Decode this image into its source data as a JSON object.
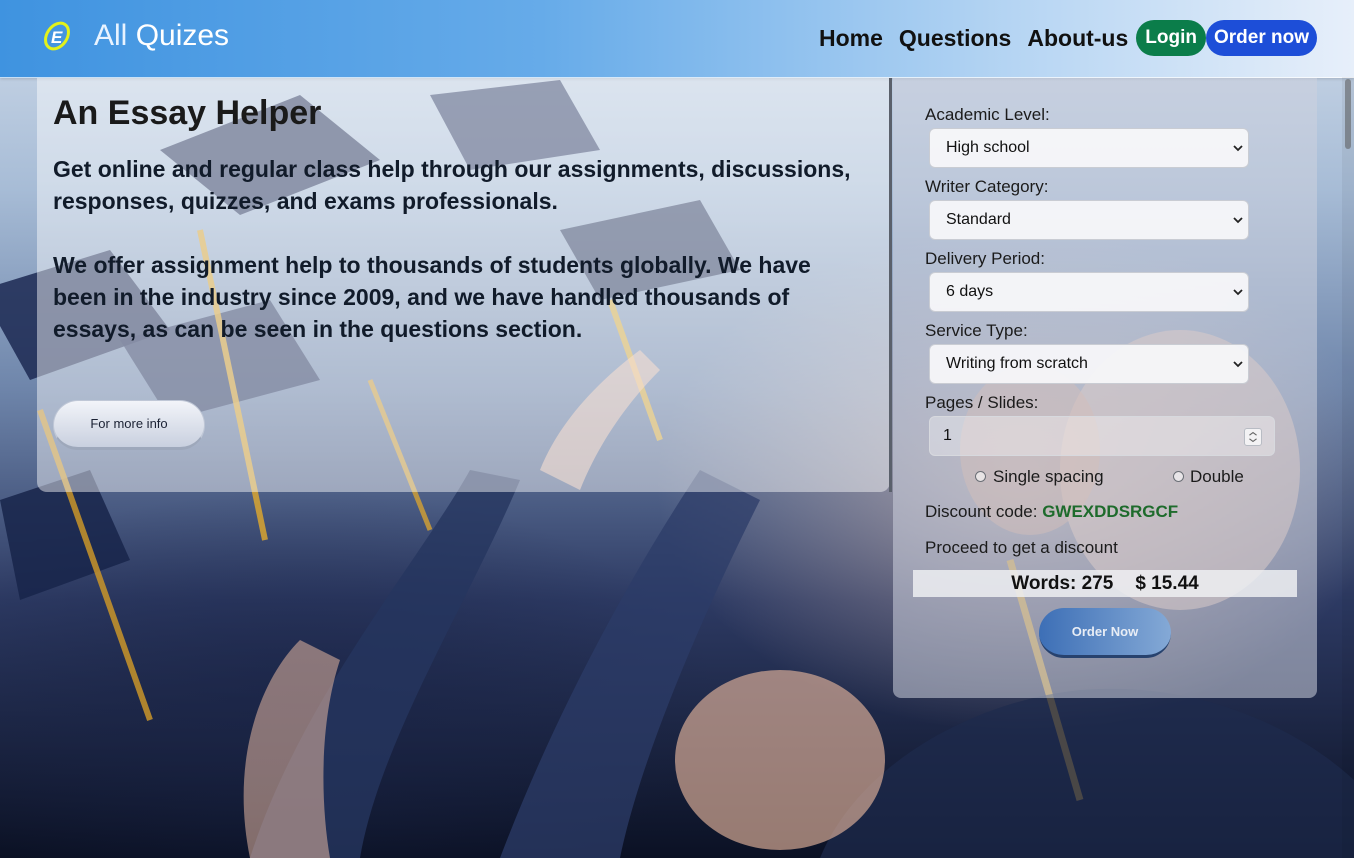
{
  "brand": {
    "logo_icon": "e-ring-logo-icon",
    "name_first": "All",
    "name_second": "Quizes"
  },
  "nav": {
    "home": "Home",
    "questions": "Questions",
    "about": "About-us",
    "login": "Login",
    "order_now": "Order now"
  },
  "hero": {
    "title": "An Essay Helper",
    "paragraph_1": "Get online and regular class help through our assignments, discussions, responses, quizzes, and exams professionals.",
    "paragraph_2": "We offer assignment help to thousands of students globally. We have been in the industry since 2009, and we have handled thousands of essays, as can be seen in the questions section.",
    "more_info_button": "For more info",
    "background_image": "graduates-throwing-caps-photo"
  },
  "order_form": {
    "academic_level": {
      "label": "Academic Level:",
      "value": "High school"
    },
    "writer_category": {
      "label": "Writer Category:",
      "value": "Standard"
    },
    "delivery_period": {
      "label": "Delivery Period:",
      "value": "6 days"
    },
    "service_type": {
      "label": "Service Type:",
      "value": "Writing from scratch"
    },
    "pages": {
      "label": "Pages / Slides:",
      "value": "1"
    },
    "spacing": {
      "options": [
        "Single spacing",
        "Double"
      ],
      "selected": null
    },
    "discount": {
      "label": "Discount code:",
      "code": "GWEXDDSRGCF"
    },
    "proceed_text": "Proceed to get a discount",
    "words_text": "Words: 275",
    "price_text": "$ 15.44",
    "order_button": "Order Now"
  },
  "colors": {
    "nav_gradient_start": "#3f93e0",
    "login_green": "#0b7d4a",
    "order_blue": "#1d4ed8",
    "discount_green": "#1e6b2c",
    "order_now_button": "#3d6fb6"
  }
}
